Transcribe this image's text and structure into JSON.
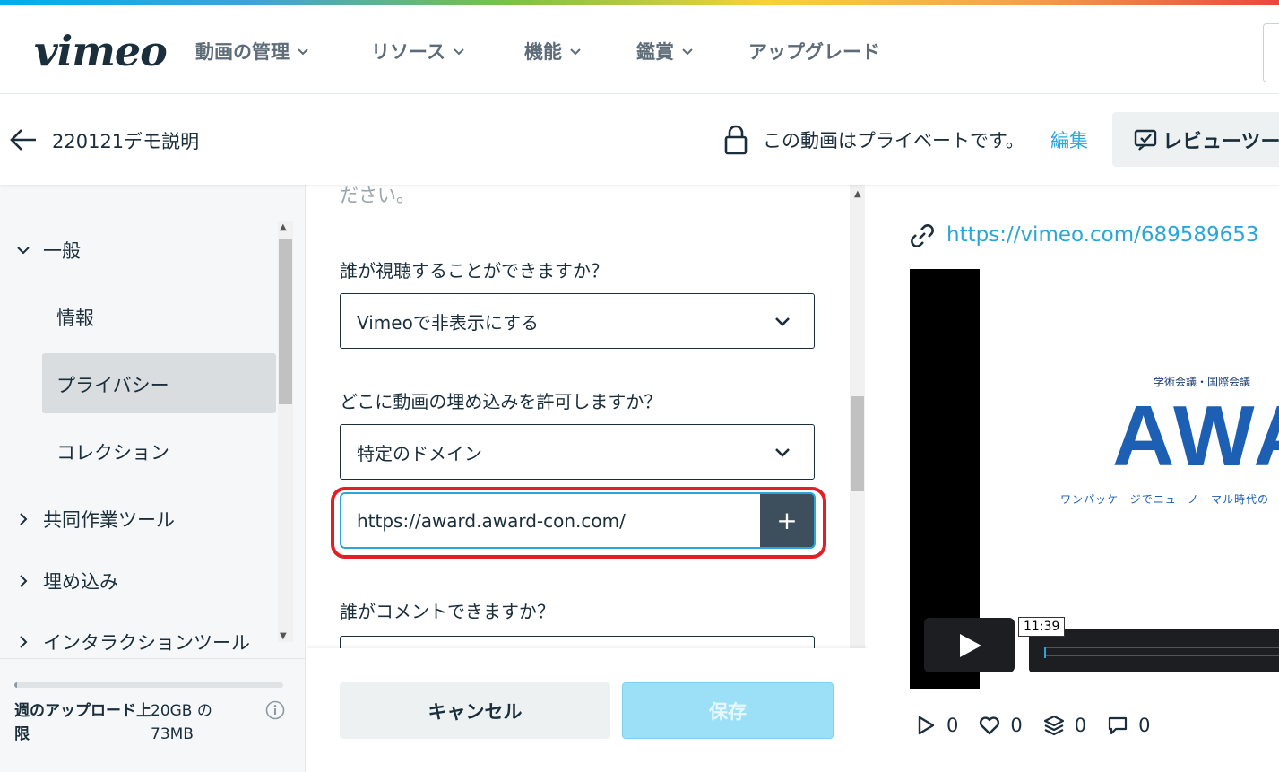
{
  "nav": {
    "logo": "vimeo",
    "items": [
      {
        "label": "動画の管理"
      },
      {
        "label": "リソース"
      },
      {
        "label": "機能"
      },
      {
        "label": "鑑賞"
      },
      {
        "label": "アップグレード"
      }
    ]
  },
  "header": {
    "video_title": "220121デモ説明",
    "privacy_text": "この動画はプライベートです。",
    "edit_link": "編集",
    "review_button": "レビューツー"
  },
  "sidebar": {
    "general": "一般",
    "info": "情報",
    "privacy": "プライバシー",
    "collection": "コレクション",
    "collab": "共同作業ツール",
    "embed": "埋め込み",
    "interaction": "インタラクションツール",
    "upload_label": "週のアップロード上限",
    "upload_value": "20GB の 73MB",
    "upload_fraction": 0.004
  },
  "form": {
    "cut_text": "ださい。",
    "q_view": "誰が視聴することができますか？",
    "view_value": "Vimeoで非表示にする",
    "q_embed": "どこに動画の埋め込みを許可しますか？",
    "embed_value": "特定のドメイン",
    "domain_value": "https://award.award-con.com/",
    "add_symbol": "+",
    "q_comment": "誰がコメントできますか？",
    "cancel": "キャンセル",
    "save": "保存"
  },
  "preview": {
    "url": "https://vimeo.com/689589653",
    "slide_sub": "学術会議・国際会議",
    "slide_brand": "AWA",
    "slide_tag": "ワンパッケージでニューノーマル時代の",
    "duration": "11:39",
    "plays": "0",
    "likes": "0",
    "collections": "0",
    "comments": "0"
  },
  "colors": {
    "accent": "#2aa6d8",
    "highlight": "#e21f26",
    "text": "#1a2e3b"
  }
}
